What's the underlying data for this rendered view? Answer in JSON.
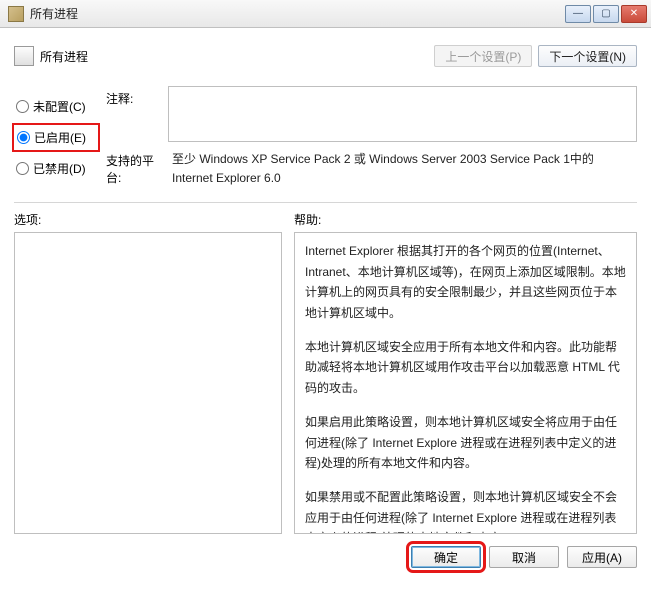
{
  "titlebar": {
    "title": "所有进程"
  },
  "header": {
    "title": "所有进程",
    "prev_btn": "上一个设置(P)",
    "next_btn": "下一个设置(N)"
  },
  "radios": {
    "not_configured": "未配置(C)",
    "enabled": "已启用(E)",
    "disabled": "已禁用(D)"
  },
  "fields": {
    "interpret_label": "注释:",
    "platform_label": "支持的平台:",
    "platform_text": "至少 Windows XP Service Pack 2 或 Windows Server 2003 Service Pack 1中的Internet Explorer 6.0"
  },
  "labels": {
    "options": "选项:",
    "help": "帮助:"
  },
  "help": {
    "p1": "Internet Explorer 根据其打开的各个网页的位置(Internet、Intranet、本地计算机区域等)，在网页上添加区域限制。本地计算机上的网页具有的安全限制最少，并且这些网页位于本地计算机区域中。",
    "p2": "本地计算机区域安全应用于所有本地文件和内容。此功能帮助减轻将本地计算机区域用作攻击平台以加载恶意 HTML 代码的攻击。",
    "p3": "如果启用此策略设置，则本地计算机区域安全将应用于由任何进程(除了 Internet Explore 进程或在进程列表中定义的进程)处理的所有本地文件和内容。",
    "p4": "如果禁用或不配置此策略设置，则本地计算机区域安全不会应用于由任何进程(除了 Internet Explore 进程或在进程列表中定义的进程)处理的本地文件和内容。"
  },
  "footer": {
    "ok": "确定",
    "cancel": "取消",
    "apply": "应用(A)"
  }
}
